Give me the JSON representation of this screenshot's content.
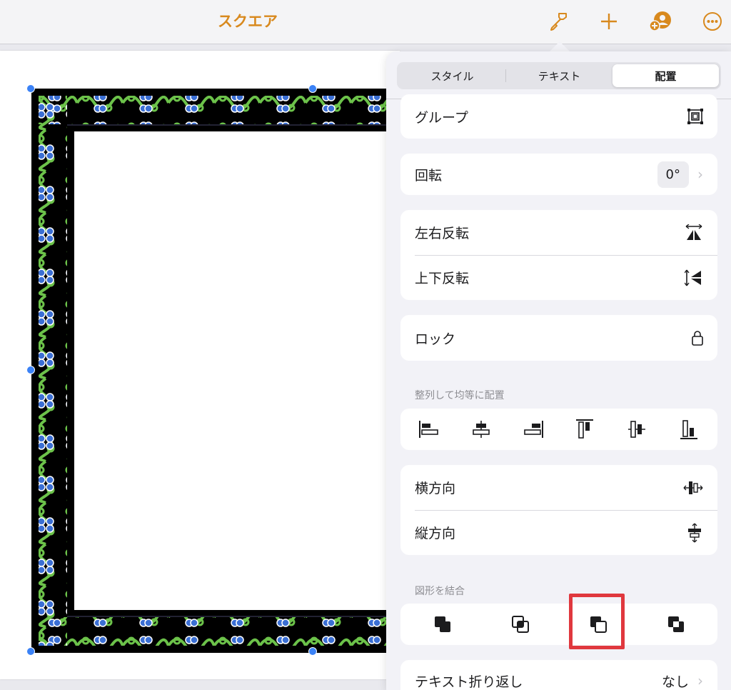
{
  "topbar": {
    "title": "スクエア",
    "accent": "#d8891e",
    "icons": [
      "paintbrush-icon",
      "plus-icon",
      "add-person-icon",
      "more-icon"
    ]
  },
  "panel": {
    "tabs": [
      "スタイル",
      "テキスト",
      "配置"
    ],
    "active_tab": "配置",
    "group_label": "グループ",
    "rotate_label": "回転",
    "rotate_value": "0°",
    "flip_h_label": "左右反転",
    "flip_v_label": "上下反転",
    "lock_label": "ロック",
    "align_section": "整列して均等に配置",
    "horizontal_label": "横方向",
    "vertical_label": "縦方向",
    "combine_section": "図形を結合",
    "text_wrap_label": "テキスト折り返し",
    "text_wrap_value": "なし"
  },
  "colors": {
    "frame_black": "#000000",
    "vine_green": "#6cc24a",
    "dot_blue": "#3b6fd4",
    "highlight_red": "#e0383e"
  }
}
